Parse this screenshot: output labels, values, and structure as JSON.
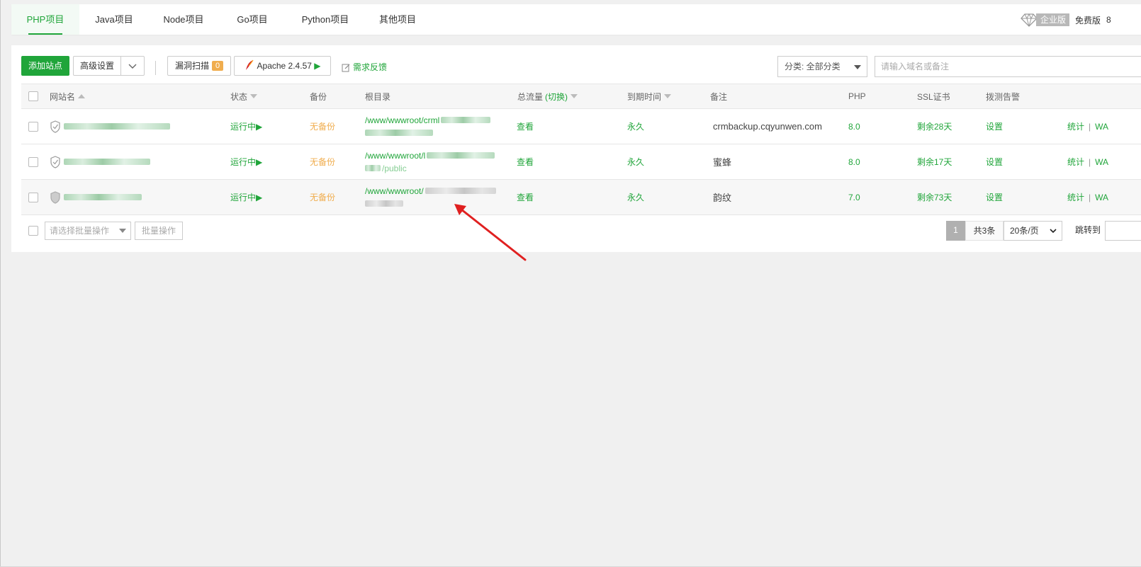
{
  "tabs": [
    {
      "label": "PHP项目",
      "active": true
    },
    {
      "label": "Java项目",
      "active": false
    },
    {
      "label": "Node项目",
      "active": false
    },
    {
      "label": "Go项目",
      "active": false
    },
    {
      "label": "Python项目",
      "active": false
    },
    {
      "label": "其他项目",
      "active": false
    }
  ],
  "topbar": {
    "edition_badge": "企业版",
    "free_label": "免费版",
    "trunc_text": "8"
  },
  "toolbar": {
    "add_site": "添加站点",
    "advanced": "高级设置",
    "vuln_scan": "漏洞扫描",
    "vuln_count": "0",
    "server": "Apache 2.4.57",
    "feedback": "需求反馈",
    "category": "分类: 全部分类",
    "search_placeholder": "请输入域名或备注"
  },
  "table": {
    "headers": {
      "site": "网站名",
      "status": "状态",
      "backup": "备份",
      "root": "根目录",
      "traffic": "总流量",
      "traffic_switch": "(切换)",
      "expire": "到期时间",
      "note": "备注",
      "php": "PHP",
      "ssl": "SSL证书",
      "probe": "拨测告警"
    },
    "rows": [
      {
        "status": "运行中",
        "backup": "无备份",
        "root": "/www/wwwroot/crml",
        "root_tail": "",
        "traffic": "查看",
        "expire": "永久",
        "note": "crmbackup.cqyunwen.com",
        "php": "8.0",
        "ssl": "剩余28天",
        "probe": "设置",
        "op_stats": "统计",
        "op_waf": "WA"
      },
      {
        "status": "运行中",
        "backup": "无备份",
        "root": "/www/wwwroot/l",
        "root_tail": "/public",
        "traffic": "查看",
        "expire": "永久",
        "note": "蜜蜂",
        "php": "8.0",
        "ssl": "剩余17天",
        "probe": "设置",
        "op_stats": "统计",
        "op_waf": "WA"
      },
      {
        "status": "运行中",
        "backup": "无备份",
        "root": "/www/wwwroot/",
        "root_tail": "",
        "traffic": "查看",
        "expire": "永久",
        "note": "韵纹",
        "php": "7.0",
        "ssl": "剩余73天",
        "probe": "设置",
        "op_stats": "统计",
        "op_waf": "WA"
      }
    ]
  },
  "footer": {
    "batch_placeholder": "请选择批量操作",
    "batch_btn": "批量操作",
    "current_page": "1",
    "total": "共3条",
    "per_page": "20条/页",
    "jump": "跳转到"
  },
  "colors": {
    "accent": "#20a53a",
    "warning": "#f0ad4e",
    "annotation": "#e02020"
  }
}
